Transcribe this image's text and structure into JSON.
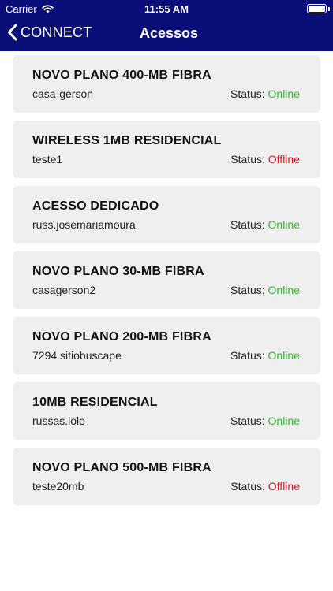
{
  "status_bar": {
    "carrier": "Carrier",
    "time": "11:55 AM",
    "battery_level": 1.0
  },
  "navbar": {
    "back_label": "CONNECT",
    "title": "Acessos"
  },
  "colors": {
    "header": "#0a0e78",
    "online": "#2eb82e",
    "offline": "#e0141e",
    "card": "#efefef"
  },
  "status_prefix": "Status:",
  "accesses": [
    {
      "plan": "NOVO PLANO 400-MB FIBRA",
      "user": "casa-gerson",
      "status": "Online"
    },
    {
      "plan": "WIRELESS 1MB RESIDENCIAL",
      "user": "teste1",
      "status": "Offline"
    },
    {
      "plan": "ACESSO DEDICADO",
      "user": "russ.josemariamoura",
      "status": "Online"
    },
    {
      "plan": "NOVO PLANO 30-MB FIBRA",
      "user": "casagerson2",
      "status": "Online"
    },
    {
      "plan": "NOVO PLANO 200-MB FIBRA",
      "user": "7294.sitiobuscape",
      "status": "Online"
    },
    {
      "plan": "10MB RESIDENCIAL",
      "user": "russas.lolo",
      "status": "Online"
    },
    {
      "plan": "NOVO PLANO 500-MB FIBRA",
      "user": "teste20mb",
      "status": "Offline"
    }
  ]
}
